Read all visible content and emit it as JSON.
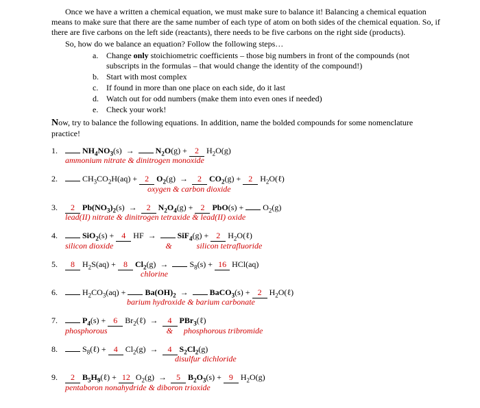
{
  "intro": "Once we have a written a chemical equation, we must make sure to balance it!  Balancing a chemical equation means to make sure that there are the same number of each type of atom on both sides of the chemical equation.  So, if there are five carbons on the left side (reactants), there needs to be five carbons on the right side (products).",
  "intro2": "So, how do we balance an equation?  Follow the following steps…",
  "steps": [
    {
      "letter": "a.",
      "text": "Change only stoichiometric coefficients – those big numbers in front of the compounds (not subscripts in the formulas – that would change the identity of the compound!)"
    },
    {
      "letter": "b.",
      "text": "Start with most complex"
    },
    {
      "letter": "c.",
      "text": "If found in more than one place on each side, do it last"
    },
    {
      "letter": "d.",
      "text": "Watch out for odd numbers (make them into even ones if needed)"
    },
    {
      "letter": "e.",
      "text": "Check your work!"
    }
  ],
  "now_bold": "N",
  "now_rest": "ow, try to balance the following equations.  In addition, name the bolded compounds for some nomenclature practice!",
  "eq1": {
    "coef1": "",
    "coef2": "",
    "coef3": "2",
    "names": "ammonium nitrate   &   dinitrogen monoxide"
  },
  "eq2": {
    "coef1": "",
    "coef2": "2",
    "coef3": "2",
    "coef4": "2",
    "names": "oxygen   &   carbon dioxide"
  },
  "eq3": {
    "coef1": "2",
    "coef2": "2",
    "coef3": "2",
    "coef4": "",
    "names": "lead(II) nitrate   &   dinitrogen tetraxide   &   lead(II) oxide"
  },
  "eq4": {
    "coef1": "",
    "coef2": "4",
    "coef3": "",
    "coef4": "2",
    "names_left": "silicon dioxide",
    "names_mid": "&",
    "names_right": "silicon tetrafluoride"
  },
  "eq5": {
    "coef1": "8",
    "coef2": "8",
    "coef3": "",
    "coef4": "16",
    "names": "chlorine"
  },
  "eq6": {
    "coef1": "",
    "coef2": "",
    "coef3": "",
    "coef4": "2",
    "names": "barium hydroxide    &   barium carbonate"
  },
  "eq7": {
    "coef1": "",
    "coef2": "6",
    "coef3": "4",
    "names_left": "phosphorous",
    "names_mid": "&",
    "names_right": "phosphorous tribromide"
  },
  "eq8": {
    "coef1": "",
    "coef2": "4",
    "coef3": "4",
    "names": "disulfur dichloride"
  },
  "eq9": {
    "coef1": "2",
    "coef2": "12",
    "coef3": "5",
    "coef4": "9",
    "names": "pentaboron nonahydride  &  diboron trioxide"
  }
}
